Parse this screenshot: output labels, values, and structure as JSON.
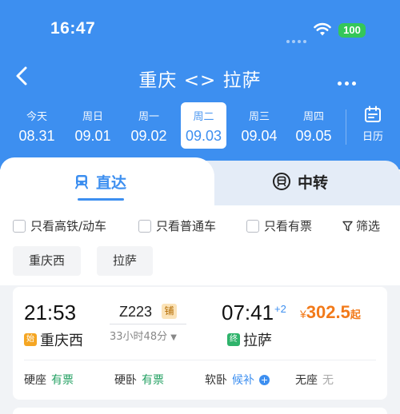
{
  "status_bar": {
    "time": "16:47",
    "battery": "100"
  },
  "header": {
    "title": "重庆 <> 拉萨"
  },
  "dates": [
    {
      "weekday": "今天",
      "date": "08.31",
      "selected": false
    },
    {
      "weekday": "周日",
      "date": "09.01",
      "selected": false
    },
    {
      "weekday": "周一",
      "date": "09.02",
      "selected": false
    },
    {
      "weekday": "周二",
      "date": "09.03",
      "selected": true
    },
    {
      "weekday": "周三",
      "date": "09.04",
      "selected": false
    },
    {
      "weekday": "周四",
      "date": "09.05",
      "selected": false
    }
  ],
  "calendar_label": "日历",
  "tabs": {
    "direct": "直达",
    "transfer": "中转"
  },
  "filters": {
    "high_speed": "只看高铁/动车",
    "normal": "只看普通车",
    "available": "只看有票",
    "filter": "筛选"
  },
  "station_chips": [
    "重庆西",
    "拉萨"
  ],
  "train": {
    "depart_time": "21:53",
    "train_no": "Z223",
    "berth_tag": "铺",
    "duration": "33小时48分",
    "arrive_time": "07:41",
    "day_offset": "+2",
    "price_symbol": "¥",
    "price": "302.5",
    "price_suffix": "起",
    "from_tag": "始",
    "from_station": "重庆西",
    "to_tag": "终",
    "to_station": "拉萨",
    "seats": [
      {
        "type": "硬座",
        "status": "有票"
      },
      {
        "type": "硬卧",
        "status": "有票"
      },
      {
        "type": "软卧",
        "status": "候补"
      },
      {
        "type": "无座",
        "status": "无"
      }
    ]
  },
  "colors": {
    "primary": "#3d8ff0",
    "price": "#f27a1a",
    "available": "#24a163",
    "from_tag": "#f5a623",
    "to_tag": "#2fb36b"
  },
  "icons": {
    "wifi": "wifi-icon",
    "back": "chevron-left-icon",
    "more": "more-icon",
    "calendar": "calendar-icon",
    "direct": "train-icon",
    "transfer": "transfer-icon",
    "filter": "funnel-icon"
  }
}
